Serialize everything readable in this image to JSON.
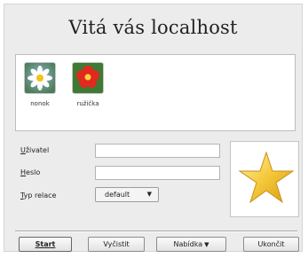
{
  "window": {
    "title": "Vitá vás localhost"
  },
  "users": [
    {
      "name": "nonok",
      "icon": "daisy-avatar-icon"
    },
    {
      "name": "ružička",
      "icon": "red-flower-avatar-icon"
    }
  ],
  "form": {
    "username": {
      "label_prefix": "U",
      "label_rest": "živatel",
      "value": ""
    },
    "password": {
      "label_prefix": "H",
      "label_rest": "eslo",
      "value": ""
    },
    "session": {
      "label_prefix": "T",
      "label_rest": "yp relace",
      "selected": "default"
    }
  },
  "logo": {
    "icon": "star-logo-icon"
  },
  "buttons": {
    "start": "Start",
    "clear": "Vyčistit",
    "menu": "Nabídka",
    "quit": "Ukončit"
  },
  "colors": {
    "frame_background": "#ececec",
    "star_fill": "#f5c83a"
  }
}
